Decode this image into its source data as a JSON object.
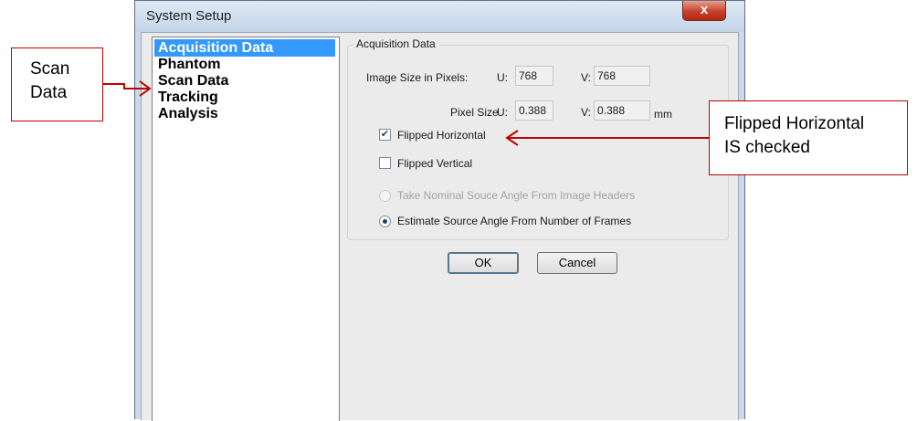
{
  "window": {
    "title": "System Setup",
    "close_glyph": "x"
  },
  "nav": {
    "items": [
      {
        "label": "Acquisition Data",
        "selected": true
      },
      {
        "label": "Phantom"
      },
      {
        "label": "Scan Data"
      },
      {
        "label": "Tracking"
      },
      {
        "label": "Analysis"
      }
    ]
  },
  "group": {
    "title": "Acquisition Data",
    "image_size_label": "Image Size in Pixels:",
    "pixel_size_label": "Pixel Size",
    "u_label": "U:",
    "v_label": "V:",
    "image_u": "768",
    "image_v": "768",
    "pixel_u": "0.388",
    "pixel_v": "0.388",
    "unit": "mm",
    "flipped_horizontal": {
      "label": "Flipped Horizontal",
      "checked": true
    },
    "flipped_vertical": {
      "label": "Flipped Vertical",
      "checked": false
    },
    "radio_nominal": {
      "label": "Take Nominal Souce Angle From Image Headers",
      "enabled": false,
      "selected": false
    },
    "radio_estimate": {
      "label": "Estimate Source Angle From Number of Frames",
      "enabled": true,
      "selected": true
    }
  },
  "buttons": {
    "ok": "OK",
    "cancel": "Cancel"
  },
  "annotations": {
    "scan_data_line1": "Scan",
    "scan_data_line2": "Data",
    "flipped_line1": "Flipped Horizontal",
    "flipped_line2": "IS checked",
    "arrow_color": "#c00000"
  }
}
